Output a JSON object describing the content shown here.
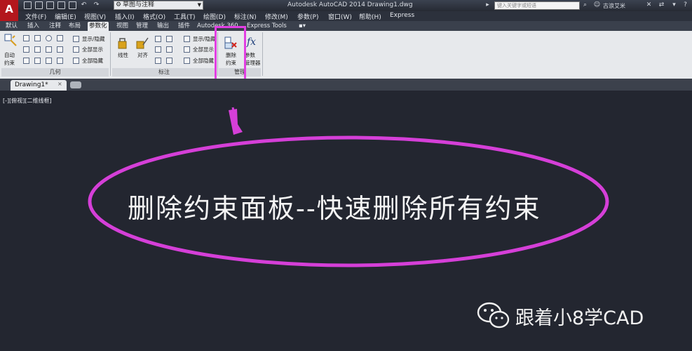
{
  "app": {
    "logo": "A",
    "title": "Autodesk AutoCAD 2014    Drawing1.dwg",
    "workspace": "草图与注释",
    "search_placeholder": "键入关键字或短语",
    "user": "古浪艾米"
  },
  "menu": [
    "文件(F)",
    "编辑(E)",
    "视图(V)",
    "插入(I)",
    "格式(O)",
    "工具(T)",
    "绘图(D)",
    "标注(N)",
    "修改(M)",
    "参数(P)",
    "窗口(W)",
    "帮助(H)",
    "Express"
  ],
  "tabs": [
    "默认",
    "插入",
    "注释",
    "布局",
    "参数化",
    "视图",
    "管理",
    "输出",
    "插件",
    "Autodesk 360",
    "Express Tools"
  ],
  "active_tab": "参数化",
  "ribbon": {
    "auto_constraint": [
      "自动",
      "约束"
    ],
    "geo_show_hide": "显示/隐藏",
    "geo_show_all": "全部显示",
    "geo_hide_all": "全部隐藏",
    "geometry_title": "几何",
    "linear": "线性",
    "aligned": "对齐",
    "dim_show_hide": "显示/隐藏",
    "dim_show_all": "全部显示",
    "dim_hide_all": "全部隐藏",
    "dimension_title": "标注",
    "delete_constraint": [
      "删除",
      "约束"
    ],
    "param_manager": [
      "参数",
      "管理器"
    ],
    "manage_title": "管理",
    "fx": "fx"
  },
  "document": {
    "tab": "Drawing1*",
    "view_label": "[-][俯视][二维线框]"
  },
  "annotation": {
    "caption": "删除约束面板--快速删除所有约束",
    "watermark": "跟着小8学CAD"
  },
  "colors": {
    "highlight": "#e23fe3",
    "canvas": "#232630"
  }
}
